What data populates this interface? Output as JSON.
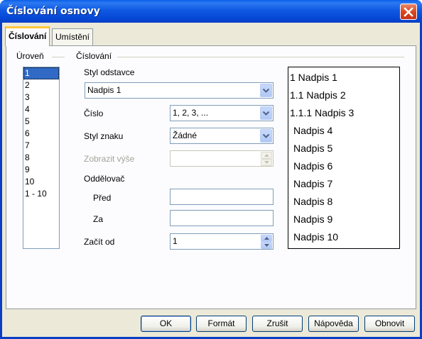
{
  "window": {
    "title": "Číslování osnovy",
    "close_icon": "close-icon"
  },
  "tabs": [
    {
      "label": "Číslování",
      "active": true
    },
    {
      "label": "Umístění",
      "active": false
    }
  ],
  "levels": {
    "header": "Úroveň",
    "items": [
      "1",
      "2",
      "3",
      "4",
      "5",
      "6",
      "7",
      "8",
      "9",
      "10",
      "1 - 10"
    ],
    "selected": "1"
  },
  "numbering": {
    "header": "Číslování",
    "paragraph_style_label": "Styl odstavce",
    "paragraph_style_value": "Nadpis 1",
    "number_label": "Číslo",
    "number_value": "1, 2, 3, ...",
    "char_style_label": "Styl znaku",
    "char_style_value": "Žádné",
    "show_sublevels_label": "Zobrazit výše",
    "show_sublevels_value": "",
    "separator_label": "Oddělovač",
    "before_label": "Před",
    "before_value": "",
    "after_label": "Za",
    "after_value": "",
    "start_at_label": "Začít od",
    "start_at_value": "1"
  },
  "preview": [
    "1 Nadpis 1",
    "1.1 Nadpis 2",
    "1.1.1 Nadpis 3",
    "Nadpis 4",
    "Nadpis 5",
    "Nadpis 6",
    "Nadpis 7",
    "Nadpis 8",
    "Nadpis 9",
    "Nadpis 10"
  ],
  "buttons": {
    "ok": "OK",
    "format": "Formát",
    "cancel": "Zrušit",
    "help": "Nápověda",
    "reset": "Obnovit"
  },
  "colors": {
    "titlebar": "#0a5ee8",
    "selection": "#316ac5",
    "close": "#d9431b",
    "dialog_bg": "#ece9d8"
  }
}
